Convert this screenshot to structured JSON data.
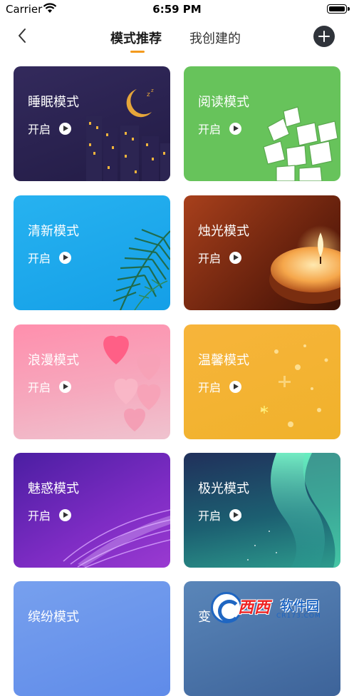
{
  "status_bar": {
    "carrier": "Carrier",
    "time": "6:59 PM"
  },
  "nav": {
    "tabs": [
      {
        "label": "模式推荐",
        "active": true
      },
      {
        "label": "我创建的",
        "active": false
      }
    ],
    "accent_color": "#f39a1e"
  },
  "cards": [
    {
      "title": "睡眠模式",
      "action": "开启"
    },
    {
      "title": "阅读模式",
      "action": "开启"
    },
    {
      "title": "清新模式",
      "action": "开启"
    },
    {
      "title": "烛光模式",
      "action": "开启"
    },
    {
      "title": "浪漫模式",
      "action": "开启"
    },
    {
      "title": "温馨模式",
      "action": "开启"
    },
    {
      "title": "魅惑模式",
      "action": "开启"
    },
    {
      "title": "极光模式",
      "action": "开启"
    },
    {
      "title": "缤纷模式",
      "action": ""
    },
    {
      "title": "变",
      "action": ""
    }
  ],
  "watermark": {
    "brand": "西西",
    "label": "软件园",
    "url": "CR173.COM"
  }
}
